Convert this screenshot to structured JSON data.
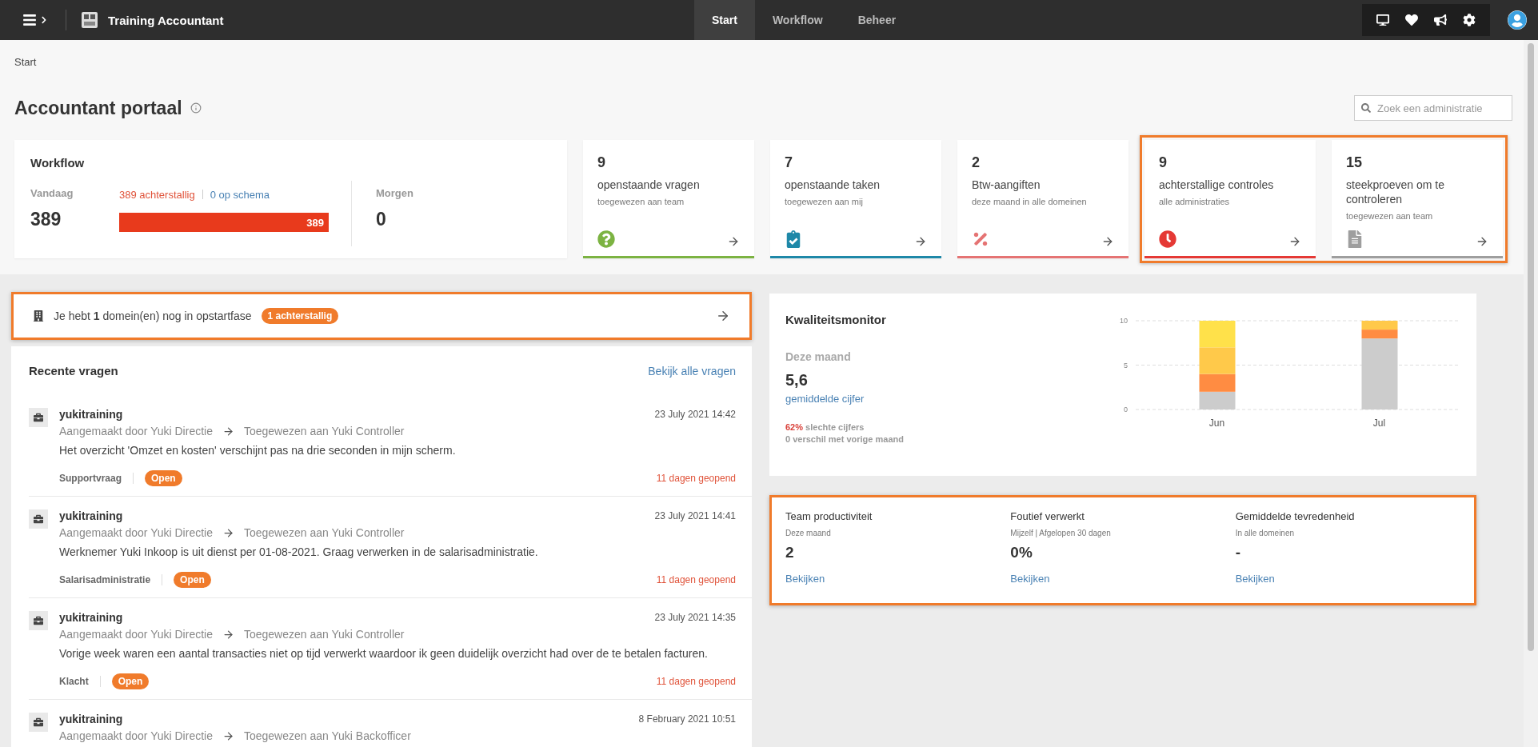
{
  "topbar": {
    "app_title": "Training Accountant",
    "nav": [
      {
        "label": "Start",
        "selected": true
      },
      {
        "label": "Workflow",
        "selected": false
      },
      {
        "label": "Beheer",
        "selected": false
      }
    ]
  },
  "breadcrumb": "Start",
  "page_title": "Accountant portaal",
  "search": {
    "placeholder": "Zoek een administratie"
  },
  "workflow": {
    "title": "Workflow",
    "today_label": "Vandaag",
    "today_value": "389",
    "overdue": "389 achterstallig",
    "on_schedule": "0 op schema",
    "bar_label": "389",
    "level": 1,
    "tomorrow_label": "Morgen",
    "tomorrow_value": "0"
  },
  "summary_cards": [
    {
      "count": "9",
      "title": "openstaande vragen",
      "subtitle": "toegewezen aan team",
      "kind": "question",
      "color": "#7cb342",
      "highlighted": false
    },
    {
      "count": "7",
      "title": "openstaande taken",
      "subtitle": "toegewezen aan mij",
      "kind": "tasks",
      "color": "#1e88a8",
      "highlighted": false
    },
    {
      "count": "2",
      "title": "Btw-aangiften",
      "subtitle": "deze maand in alle domeinen",
      "kind": "tax",
      "color": "#e57373",
      "highlighted": false
    },
    {
      "count": "9",
      "title": "achterstallige controles",
      "subtitle": "alle administraties",
      "kind": "overdue",
      "color": "#e53935",
      "highlighted": true
    },
    {
      "count": "15",
      "title": "steekproeven om te controleren",
      "subtitle": "toegewezen aan team",
      "kind": "sample",
      "color": "#9e9e9e",
      "highlighted": true
    }
  ],
  "notice": {
    "text": "Je hebt **1** domein(en) nog in opstartfase",
    "badge": "1 achterstallig",
    "highlighted": true
  },
  "recent_questions": {
    "title": "Recente vragen",
    "link": "Bekijk alle vragen",
    "items": [
      {
        "company": "yukitraining",
        "date": "23 July 2021 14:42",
        "created_by": "Aangemaakt door Yuki Directie",
        "assigned_to": "Toegewezen aan Yuki Controller",
        "message": "Het overzicht 'Omzet en kosten' verschijnt pas na drie seconden in mijn scherm.",
        "category": "Supportvraag",
        "status": "Open",
        "age": "11 dagen geopend"
      },
      {
        "company": "yukitraining",
        "date": "23 July 2021 14:41",
        "created_by": "Aangemaakt door Yuki Directie",
        "assigned_to": "Toegewezen aan Yuki Controller",
        "message": "Werknemer Yuki Inkoop is uit dienst per 01-08-2021. Graag verwerken in de salarisadministratie.",
        "category": "Salarisadministratie",
        "status": "Open",
        "age": "11 dagen geopend"
      },
      {
        "company": "yukitraining",
        "date": "23 July 2021 14:35",
        "created_by": "Aangemaakt door Yuki Directie",
        "assigned_to": "Toegewezen aan Yuki Controller",
        "message": "Vorige week waren een aantal transacties niet op tijd verwerkt waardoor ik geen duidelijk overzicht had over de te betalen facturen.",
        "category": "Klacht",
        "status": "Open",
        "age": "11 dagen geopend"
      },
      {
        "company": "yukitraining",
        "date": "8 February 2021 10:51",
        "created_by": "Aangemaakt door Yuki Directie",
        "assigned_to": "Toegewezen aan Yuki Backofficer"
      }
    ]
  },
  "quality_monitor": {
    "title": "Kwaliteitsmonitor",
    "period": "Deze maand",
    "score": "5,6",
    "score_label": "gemiddelde cijfer",
    "bad_pct": "62%",
    "bad_label": "slechte cijfers",
    "difference": "0 verschil met vorige maand",
    "chart_data": {
      "type": "bar",
      "stacked": true,
      "categories": [
        "Jun",
        "Jul"
      ],
      "ylim": [
        0,
        10
      ],
      "yticks": [
        0,
        5,
        10
      ],
      "series": [
        {
          "color": "#cccccc",
          "values": [
            2,
            8
          ]
        },
        {
          "color": "#ff8c42",
          "values": [
            2,
            1
          ]
        },
        {
          "color": "#ffc94a",
          "values": [
            3,
            1
          ]
        },
        {
          "color": "#ffe14a",
          "values": [
            3,
            0
          ]
        }
      ]
    }
  },
  "stats": {
    "highlighted": true,
    "items": [
      {
        "title": "Team productiviteit",
        "subtitle": "Deze maand",
        "value": "2",
        "link": "Bekijken"
      },
      {
        "title": "Foutief verwerkt",
        "subtitle": "Mijzelf | Afgelopen 30 dagen",
        "value": "0%",
        "link": "Bekijken"
      },
      {
        "title": "Gemiddelde tevredenheid",
        "subtitle": "In alle domeinen",
        "value": "-",
        "link": "Bekijken"
      }
    ]
  }
}
